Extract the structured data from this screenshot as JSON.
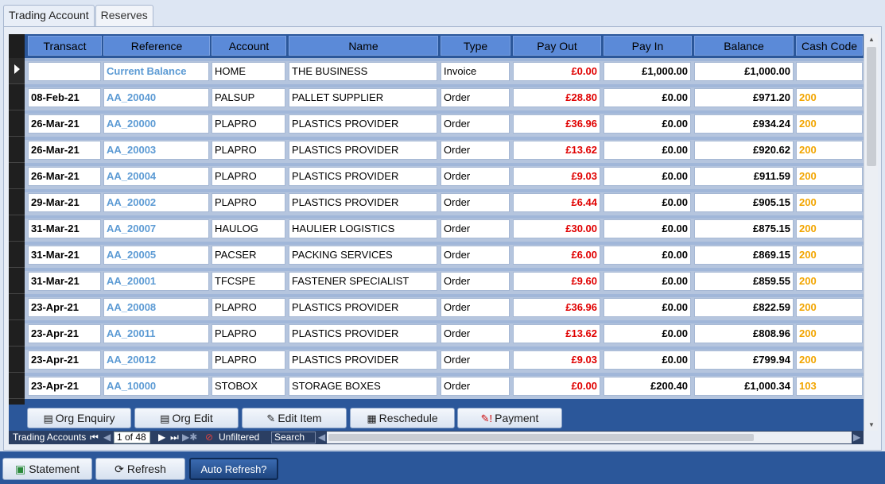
{
  "tabs": [
    "Trading Account",
    "Reserves"
  ],
  "columns": [
    "Transact",
    "Reference",
    "Account",
    "Name",
    "Type",
    "Pay Out",
    "Pay In",
    "Balance",
    "Cash Code"
  ],
  "rows": [
    {
      "transact": "",
      "reference": "Current Balance",
      "account": "HOME",
      "name": "THE BUSINESS",
      "type": "Invoice",
      "pay_out": "£0.00",
      "pay_in": "£1,000.00",
      "balance": "£1,000.00",
      "cash_code": ""
    },
    {
      "transact": "08-Feb-21",
      "reference": "AA_20040",
      "account": "PALSUP",
      "name": "PALLET SUPPLIER",
      "type": "Order",
      "pay_out": "£28.80",
      "pay_in": "£0.00",
      "balance": "£971.20",
      "cash_code": "200"
    },
    {
      "transact": "26-Mar-21",
      "reference": "AA_20000",
      "account": "PLAPRO",
      "name": "PLASTICS PROVIDER",
      "type": "Order",
      "pay_out": "£36.96",
      "pay_in": "£0.00",
      "balance": "£934.24",
      "cash_code": "200"
    },
    {
      "transact": "26-Mar-21",
      "reference": "AA_20003",
      "account": "PLAPRO",
      "name": "PLASTICS PROVIDER",
      "type": "Order",
      "pay_out": "£13.62",
      "pay_in": "£0.00",
      "balance": "£920.62",
      "cash_code": "200"
    },
    {
      "transact": "26-Mar-21",
      "reference": "AA_20004",
      "account": "PLAPRO",
      "name": "PLASTICS PROVIDER",
      "type": "Order",
      "pay_out": "£9.03",
      "pay_in": "£0.00",
      "balance": "£911.59",
      "cash_code": "200"
    },
    {
      "transact": "29-Mar-21",
      "reference": "AA_20002",
      "account": "PLAPRO",
      "name": "PLASTICS PROVIDER",
      "type": "Order",
      "pay_out": "£6.44",
      "pay_in": "£0.00",
      "balance": "£905.15",
      "cash_code": "200"
    },
    {
      "transact": "31-Mar-21",
      "reference": "AA_20007",
      "account": "HAULOG",
      "name": "HAULIER LOGISTICS",
      "type": "Order",
      "pay_out": "£30.00",
      "pay_in": "£0.00",
      "balance": "£875.15",
      "cash_code": "200"
    },
    {
      "transact": "31-Mar-21",
      "reference": "AA_20005",
      "account": "PACSER",
      "name": "PACKING SERVICES",
      "type": "Order",
      "pay_out": "£6.00",
      "pay_in": "£0.00",
      "balance": "£869.15",
      "cash_code": "200"
    },
    {
      "transact": "31-Mar-21",
      "reference": "AA_20001",
      "account": "TFCSPE",
      "name": "FASTENER SPECIALIST",
      "type": "Order",
      "pay_out": "£9.60",
      "pay_in": "£0.00",
      "balance": "£859.55",
      "cash_code": "200"
    },
    {
      "transact": "23-Apr-21",
      "reference": "AA_20008",
      "account": "PLAPRO",
      "name": "PLASTICS PROVIDER",
      "type": "Order",
      "pay_out": "£36.96",
      "pay_in": "£0.00",
      "balance": "£822.59",
      "cash_code": "200"
    },
    {
      "transact": "23-Apr-21",
      "reference": "AA_20011",
      "account": "PLAPRO",
      "name": "PLASTICS PROVIDER",
      "type": "Order",
      "pay_out": "£13.62",
      "pay_in": "£0.00",
      "balance": "£808.96",
      "cash_code": "200"
    },
    {
      "transact": "23-Apr-21",
      "reference": "AA_20012",
      "account": "PLAPRO",
      "name": "PLASTICS PROVIDER",
      "type": "Order",
      "pay_out": "£9.03",
      "pay_in": "£0.00",
      "balance": "£799.94",
      "cash_code": "200"
    },
    {
      "transact": "23-Apr-21",
      "reference": "AA_10000",
      "account": "STOBOX",
      "name": "STORAGE BOXES",
      "type": "Order",
      "pay_out": "£0.00",
      "pay_in": "£200.40",
      "balance": "£1,000.34",
      "cash_code": "103"
    }
  ],
  "form_buttons": {
    "org_enquiry": "Org Enquiry",
    "org_edit": "Org Edit",
    "edit_item": "Edit Item",
    "reschedule": "Reschedule",
    "payment": "Payment"
  },
  "navigation": {
    "label": "Trading Accounts",
    "record": "1 of 48",
    "filter": "Unfiltered",
    "search": "Search"
  },
  "bottom_buttons": {
    "statement": "Statement",
    "refresh": "Refresh",
    "auto_refresh": "Auto Refresh?"
  },
  "colors": {
    "accent": "#2b579a",
    "header": "#5b8ad8",
    "pay_out": "#e00000",
    "reference": "#5d9bd4",
    "cash_code": "#f2a500"
  },
  "icons": {
    "org_enquiry": "form-icon",
    "org_edit": "form-icon",
    "edit_item": "pencil-icon",
    "reschedule": "calendar-icon",
    "payment": "payment-icon",
    "statement": "statement-icon",
    "refresh": "refresh-icon",
    "filter": "filter-icon"
  }
}
